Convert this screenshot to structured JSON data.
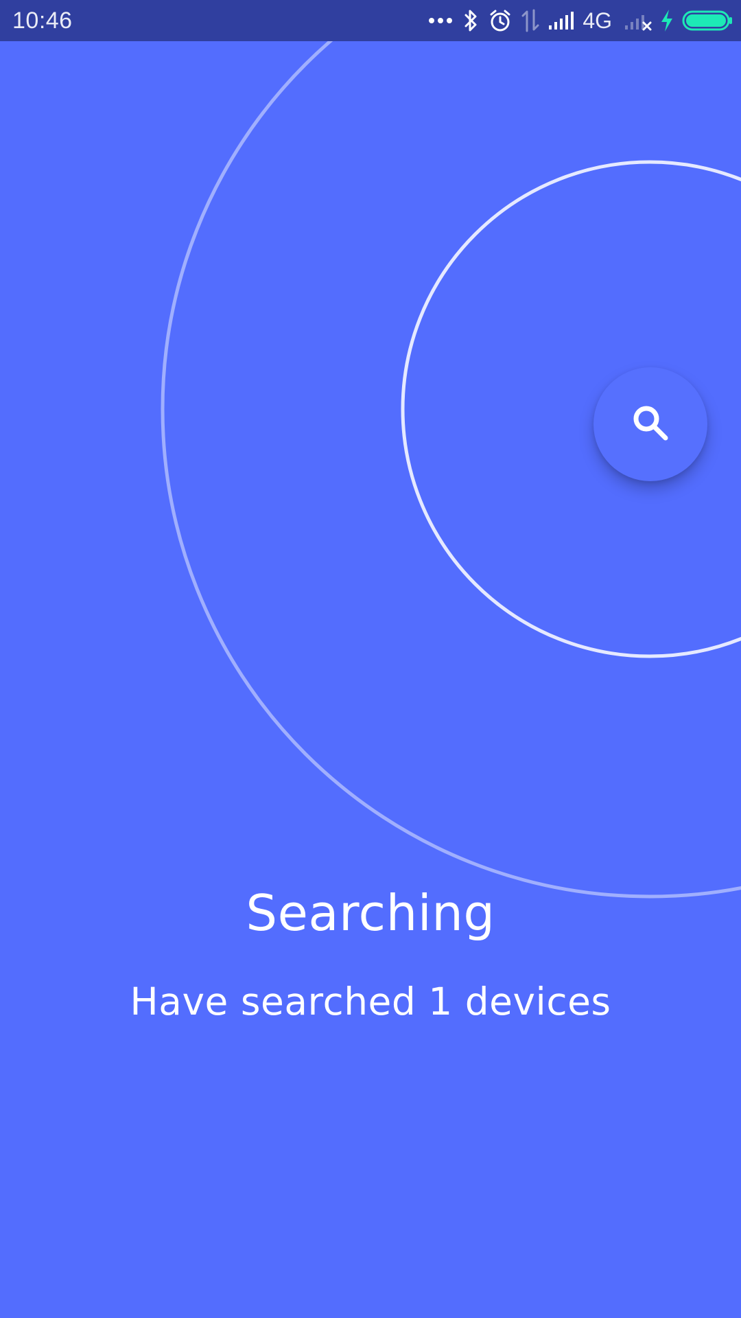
{
  "status_bar": {
    "time": "10:46",
    "network_type": "4G",
    "icons": [
      "more-dots-icon",
      "bluetooth-icon",
      "alarm-icon",
      "data-transfer-icon",
      "signal-icon",
      "no-signal-icon",
      "charging-bolt-icon",
      "battery-icon"
    ],
    "background_color": "#303F9F",
    "battery_color": "#1DE9B6",
    "charging_color": "#1DE9B6"
  },
  "main": {
    "background_color": "#536DFE",
    "title": "Searching",
    "subtitle": "Have searched 1 devices",
    "search_button_icon": "search-icon"
  }
}
